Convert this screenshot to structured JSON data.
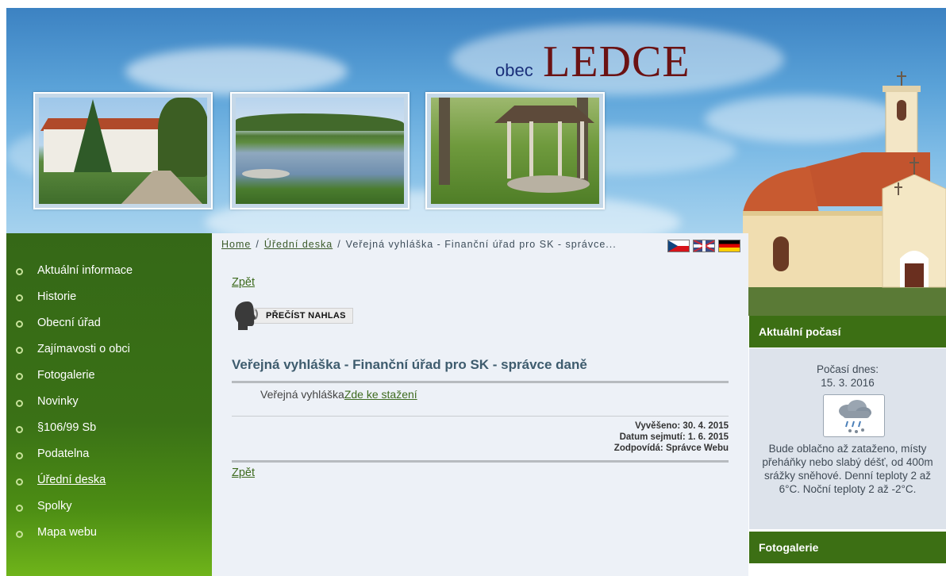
{
  "header": {
    "prefix": "obec",
    "name": "LEDCE"
  },
  "icons": {
    "photos": [
      "castle-photo",
      "pond-photo",
      "gazebo-photo"
    ],
    "church": "church-photo",
    "tts": "speaking-head-icon",
    "weather": "rain-snow-cloud-icon",
    "flags": [
      "flag-cz-icon",
      "flag-uk-icon",
      "flag-de-icon"
    ]
  },
  "colors": {
    "sidebar_green": "#3a7116",
    "heading_green": "#3c6f14",
    "link_green": "#3e6b1f",
    "title_slate": "#3e5c6e",
    "wordmark_red": "#6b1213",
    "wordmark_blue": "#1a2f7a"
  },
  "sidebar": {
    "items": [
      {
        "label": "Aktuální informace"
      },
      {
        "label": "Historie"
      },
      {
        "label": "Obecní úřad"
      },
      {
        "label": "Zajímavosti o obci"
      },
      {
        "label": "Fotogalerie"
      },
      {
        "label": "Novinky"
      },
      {
        "label": "§106/99 Sb"
      },
      {
        "label": "Podatelna"
      },
      {
        "label": "Úřední deska",
        "active": true
      },
      {
        "label": "Spolky"
      },
      {
        "label": "Mapa webu"
      }
    ]
  },
  "breadcrumb": {
    "home": "Home",
    "sep": "/",
    "section": "Úřední deska",
    "current": "Veřejná vyhláška - Finanční úřad pro SK - správce..."
  },
  "main": {
    "back_top": "Zpět",
    "back_bottom": "Zpět",
    "tts_label": "PŘEČÍST NAHLAS",
    "title": "Veřejná vyhláška - Finanční úřad pro SK - správce daně",
    "download_prefix": "Veřejná vyhláška",
    "download_link": "Zde ke stažení",
    "posted": "Vyvěšeno: 30. 4. 2015",
    "removed": "Datum sejmutí: 1. 6. 2015",
    "responsible": "Zodpovídá: Správce Webu"
  },
  "weather": {
    "heading": "Aktuální počasí",
    "today_label": "Počasí dnes:",
    "date": "15. 3. 2016",
    "description": "Bude oblačno až zataženo, místy přeháňky nebo slabý déšť, od 400m srážky sněhové. Denní teploty 2 až 6°C. Noční teploty 2 až -2°C."
  },
  "gallery": {
    "heading": "Fotogalerie"
  }
}
